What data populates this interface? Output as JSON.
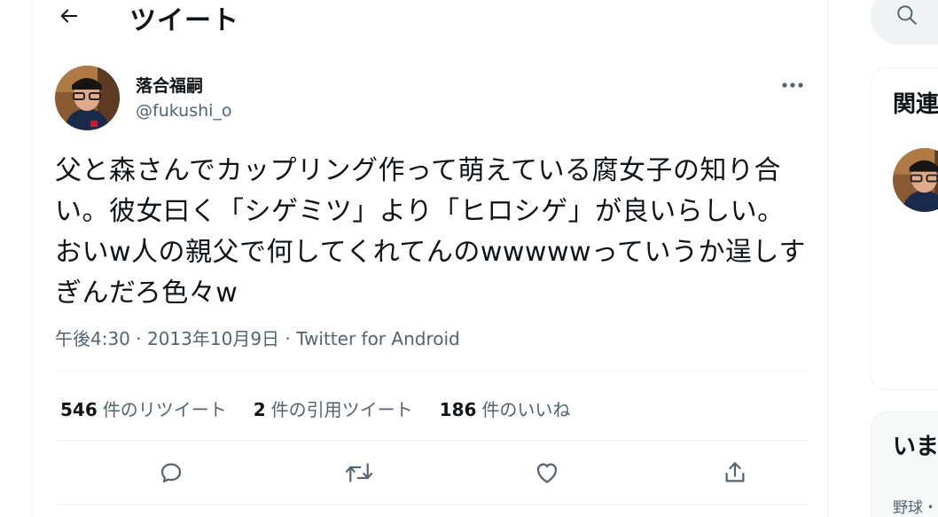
{
  "header": {
    "title": "ツイート"
  },
  "tweet": {
    "author_name": "落合福嗣",
    "author_handle": "@fukushi_o",
    "text": "父と森さんでカップリング作って萌えている腐女子の知り合い。彼女曰く「シゲミツ」より「ヒロシゲ」が良いらしい。おいw人の親父で何してくれてんのwwwwwっていうか逞しすぎんだろ色々w",
    "time": "午後4:30 · 2013年10月9日",
    "separator": " · ",
    "source": "Twitter for Android"
  },
  "stats": [
    {
      "count": "546",
      "label": "件のリツイート"
    },
    {
      "count": "2",
      "label": "件の引用ツイート"
    },
    {
      "count": "186",
      "label": "件のいいね"
    }
  ],
  "sidebar": {
    "related_title": "関連",
    "trends_title": "いま",
    "trend_item": "野球・"
  },
  "colors": {
    "text": "#0f1419",
    "secondary": "#536471",
    "border": "#eff3f4"
  }
}
